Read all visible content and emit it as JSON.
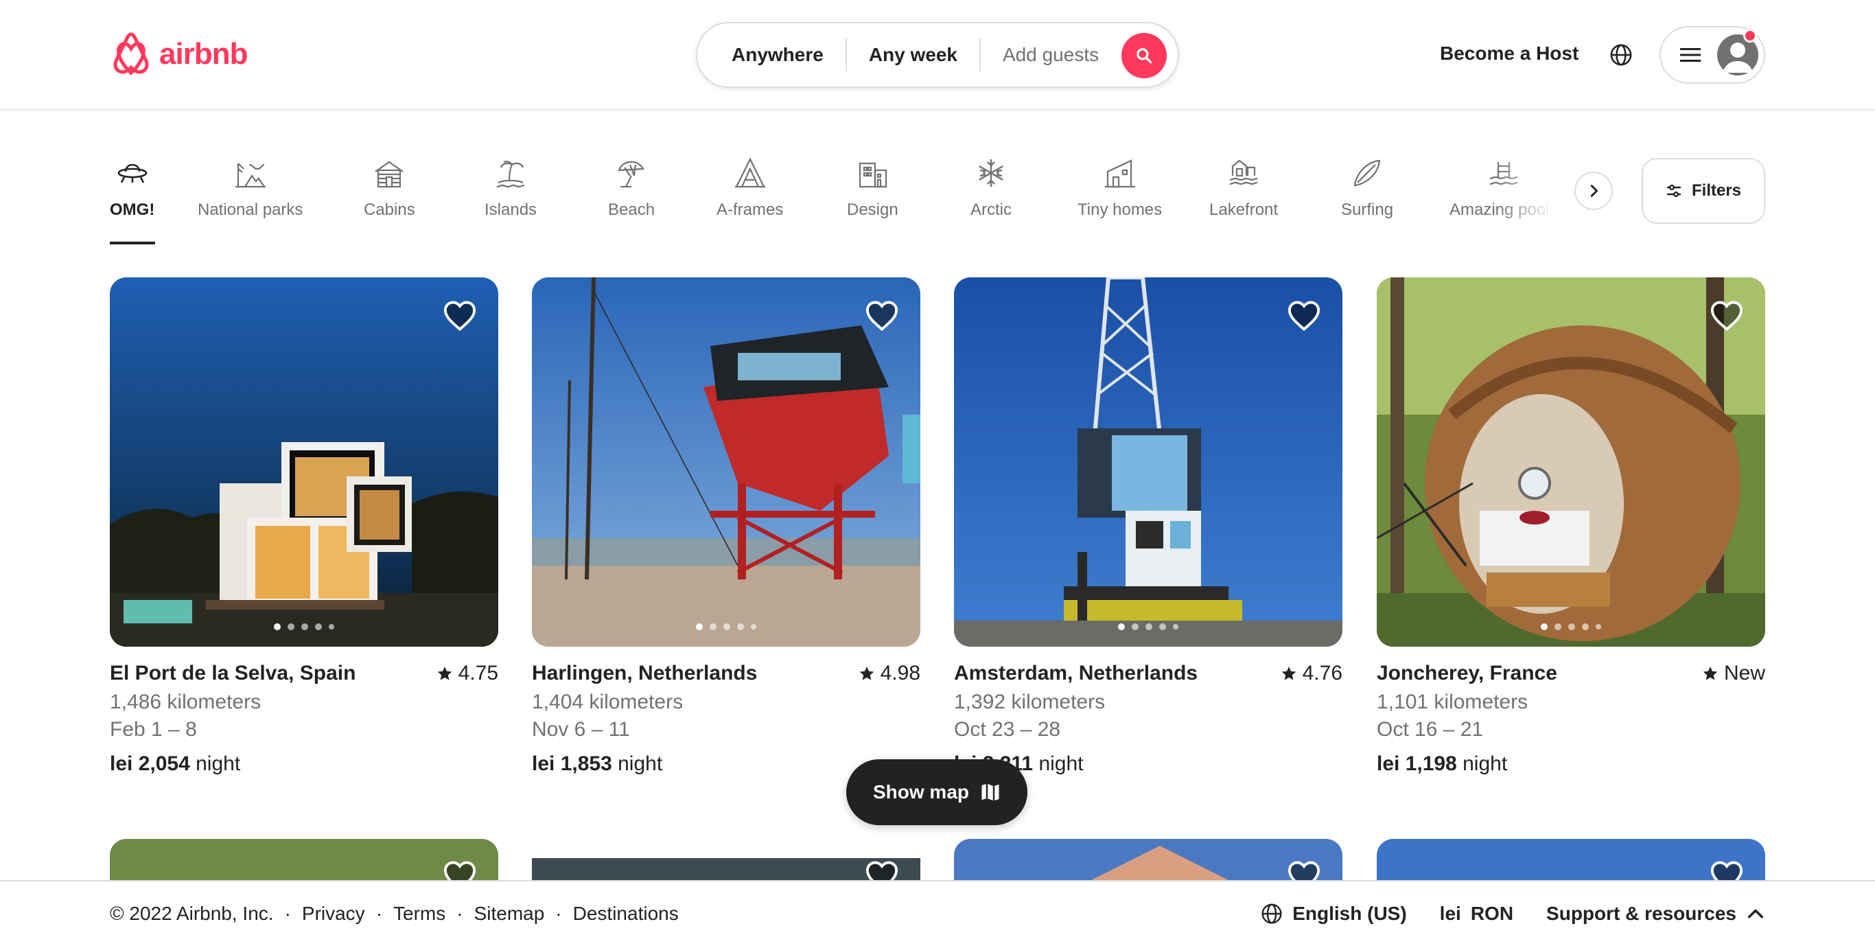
{
  "brand": {
    "name": "airbnb",
    "color": "#FF385C"
  },
  "search": {
    "location": "Anywhere",
    "dates": "Any week",
    "guests": "Add guests",
    "button_icon": "search-icon"
  },
  "header": {
    "host_label": "Become a Host",
    "globe_icon": "globe-icon",
    "menu_icon": "hamburger-menu-icon",
    "avatar_icon": "user-avatar-icon"
  },
  "categories": [
    {
      "label": "OMG!",
      "icon": "ufo-icon",
      "active": true
    },
    {
      "label": "National parks",
      "icon": "national-park-icon"
    },
    {
      "label": "Cabins",
      "icon": "cabin-icon"
    },
    {
      "label": "Islands",
      "icon": "island-icon"
    },
    {
      "label": "Beach",
      "icon": "beach-umbrella-icon"
    },
    {
      "label": "A-frames",
      "icon": "a-frame-icon"
    },
    {
      "label": "Design",
      "icon": "design-building-icon"
    },
    {
      "label": "Arctic",
      "icon": "snowflake-icon"
    },
    {
      "label": "Tiny homes",
      "icon": "tiny-home-icon"
    },
    {
      "label": "Lakefront",
      "icon": "lakefront-icon"
    },
    {
      "label": "Surfing",
      "icon": "surfboard-icon"
    },
    {
      "label": "Amazing pools",
      "icon": "pool-icon"
    }
  ],
  "filters": {
    "label": "Filters",
    "icon": "filters-icon"
  },
  "listings": [
    {
      "title": "El Port de la Selva, Spain",
      "rating": "4.75",
      "distance": "1,486 kilometers",
      "dates": "Feb 1 – 8",
      "price": "lei 2,054",
      "unit": "night"
    },
    {
      "title": "Harlingen, Netherlands",
      "rating": "4.98",
      "distance": "1,404 kilometers",
      "dates": "Nov 6 – 11",
      "price": "lei 1,853",
      "unit": "night"
    },
    {
      "title": "Amsterdam, Netherlands",
      "rating": "4.76",
      "distance": "1,392 kilometers",
      "dates": "Oct 23 – 28",
      "price": "lei 2,211",
      "unit": "night"
    },
    {
      "title": "Joncherey, France",
      "rating": "New",
      "distance": "1,101 kilometers",
      "dates": "Oct 16 – 21",
      "price": "lei 1,198",
      "unit": "night"
    }
  ],
  "show_map": {
    "label": "Show map",
    "icon": "map-icon"
  },
  "footer": {
    "copyright": "© 2022 Airbnb, Inc.",
    "links": [
      "Privacy",
      "Terms",
      "Sitemap",
      "Destinations"
    ],
    "language": "English (US)",
    "currency_symbol": "lei",
    "currency": "RON",
    "support": "Support & resources"
  }
}
